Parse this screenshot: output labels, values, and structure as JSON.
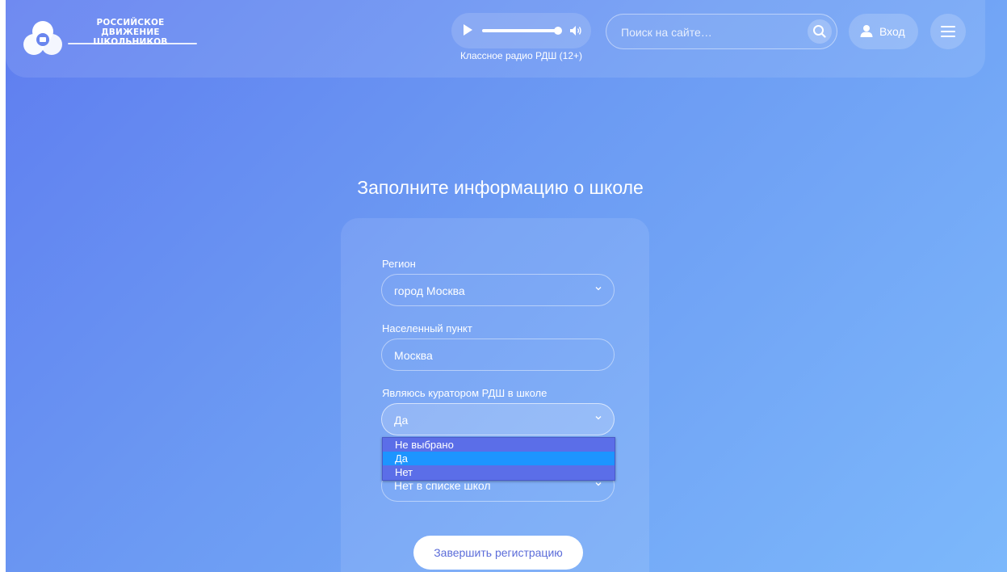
{
  "header": {
    "logo": {
      "line1": "РОССИЙСКОЕ",
      "line2": "ДВИЖЕНИЕ ШКОЛЬНИКОВ"
    },
    "player": {
      "caption": "Классное радио РДШ (12+)",
      "progress": 0.92
    },
    "search": {
      "placeholder": "Поиск на сайте…"
    },
    "login_label": "Вход"
  },
  "form": {
    "title": "Заполните информацию о школе",
    "region": {
      "label": "Регион",
      "value": "город Москва"
    },
    "locality": {
      "label": "Населенный пункт",
      "value": "Москва"
    },
    "curator": {
      "label": "Являюсь куратором РДШ в школе",
      "value": "Да"
    },
    "dropdown_options": [
      {
        "label": "Не выбрано",
        "selected": false
      },
      {
        "label": "Да",
        "selected": true
      },
      {
        "label": "Нет",
        "selected": false
      }
    ],
    "school": {
      "value": "Нет в списке школ"
    },
    "submit_label": "Завершить регистрацию"
  },
  "colors": {
    "bg_start": "#5f7df0",
    "bg_end": "#7cb8fb",
    "dropdown_bg": "#5b6ee8",
    "dropdown_selected": "#1d95ff",
    "submit_text": "#5b6cd9"
  }
}
